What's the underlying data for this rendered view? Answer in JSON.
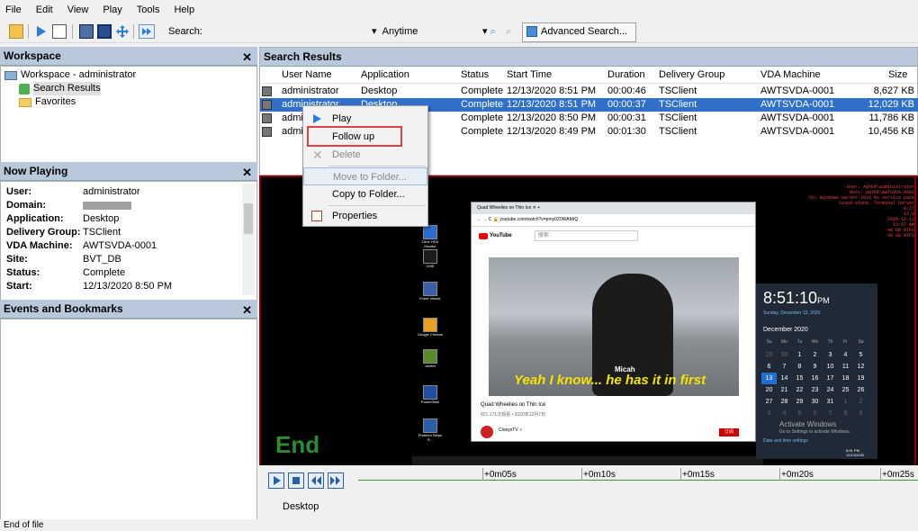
{
  "menu": [
    "File",
    "Edit",
    "View",
    "Play",
    "Tools",
    "Help"
  ],
  "toolbar": {
    "search_label": "Search:",
    "time_filter": "Anytime",
    "advanced_search": "Advanced Search..."
  },
  "workspace": {
    "title": "Workspace",
    "root": "Workspace - administrator",
    "items": [
      "Search Results",
      "Favorites"
    ]
  },
  "now_playing": {
    "title": "Now Playing",
    "fields": [
      {
        "k": "User:",
        "v": "administrator"
      },
      {
        "k": "Domain:",
        "v": ""
      },
      {
        "k": "Application:",
        "v": "Desktop"
      },
      {
        "k": "Delivery Group:",
        "v": "TSClient"
      },
      {
        "k": "VDA Machine:",
        "v": "AWTSVDA-0001"
      },
      {
        "k": "Site:",
        "v": "BVT_DB"
      },
      {
        "k": "Status:",
        "v": "Complete"
      },
      {
        "k": "Start:",
        "v": "12/13/2020 8:50 PM"
      }
    ]
  },
  "events": {
    "title": "Events and Bookmarks"
  },
  "search_results": {
    "title": "Search Results",
    "columns": [
      "User Name",
      "Application",
      "Status",
      "Start Time",
      "Duration",
      "Delivery Group",
      "VDA Machine",
      "Size"
    ],
    "rows": [
      [
        "administrator",
        "Desktop",
        "Complete",
        "12/13/2020 8:51 PM",
        "00:00:46",
        "TSClient",
        "AWTSVDA-0001",
        "8,627 KB"
      ],
      [
        "administrator",
        "Desktop",
        "Complete",
        "12/13/2020 8:51 PM",
        "00:00:37",
        "TSClient",
        "AWTSVDA-0001",
        "12,029 KB"
      ],
      [
        "admini",
        "",
        "Complete",
        "12/13/2020 8:50 PM",
        "00:00:31",
        "TSClient",
        "AWTSVDA-0001",
        "11,786 KB"
      ],
      [
        "admini",
        "",
        "Complete",
        "12/13/2020 8:49 PM",
        "00:01:30",
        "TSClient",
        "AWTSVDA-0001",
        "10,456 KB"
      ]
    ]
  },
  "context_menu": {
    "items": [
      "Play",
      "Follow up",
      "Delete",
      "Move to Folder...",
      "Copy to Folder...",
      "Properties"
    ]
  },
  "video": {
    "end_text": "End",
    "desktop_icons": [
      "Citrix HDX Monitor",
      "CMD",
      "Event Viewer",
      "Google Chrome",
      "Jmeter",
      "PowerShell",
      "Problem Steps R..."
    ],
    "browser": {
      "tab": "Quad Wheelies on Thin Ice",
      "url": "youtube.com/watch?v=pmy0Z0WAMrQ",
      "search_placeholder": "搜索",
      "video_title": "Quad Wheelies on Thin Ice",
      "video_meta": "821,171次观看 • 2020年12月7日",
      "subtitle_name": "Micah",
      "subtitle": "Yeah I know... he has it in first",
      "channel": "CloeysTV ✓",
      "subscribe": "订阅",
      "brand": "YouTube"
    },
    "clock": {
      "time": "8:51:10",
      "ampm": "PM",
      "date": "Sunday, December 13, 2020",
      "month": "December 2020",
      "days": [
        "Su",
        "Mo",
        "Tu",
        "We",
        "Th",
        "Fr",
        "Sa"
      ],
      "weeks": [
        [
          "29",
          "30",
          "1",
          "2",
          "3",
          "4",
          "5"
        ],
        [
          "6",
          "7",
          "8",
          "9",
          "10",
          "11",
          "12"
        ],
        [
          "13",
          "14",
          "15",
          "16",
          "17",
          "18",
          "19"
        ],
        [
          "20",
          "21",
          "22",
          "23",
          "24",
          "25",
          "26"
        ],
        [
          "27",
          "28",
          "29",
          "30",
          "31",
          "1",
          "2"
        ],
        [
          "3",
          "4",
          "5",
          "6",
          "7",
          "8",
          "9"
        ]
      ],
      "activate": "Activate Windows",
      "activate_sub": "Go to Settings to activate Windows.",
      "settings": "Date and time settings",
      "tray_time": "8:51 PM",
      "tray_date": "12/13/2020"
    },
    "terminal": [
      "User: AQYER\\administrator",
      "Host: AQYER\\AWTSVDA-0001",
      "OS: Windows Server 2016 No service pack",
      "Stand-alone, Terminal Server",
      "0:27",
      "13.0",
      "2020-12-13",
      "13:07 AM",
      "48 GB NTFS",
      "48 GB NTFS"
    ]
  },
  "timeline": {
    "ticks": [
      "+0m05s",
      "+0m10s",
      "+0m15s",
      "+0m20s",
      "+0m25s"
    ],
    "app_label": "Desktop"
  },
  "status": "End of file",
  "colors": {
    "accent": "#3070c8",
    "panel_header": "#b9c9db",
    "end_text": "#2e8b2e",
    "highlight_box": "#e04040"
  }
}
